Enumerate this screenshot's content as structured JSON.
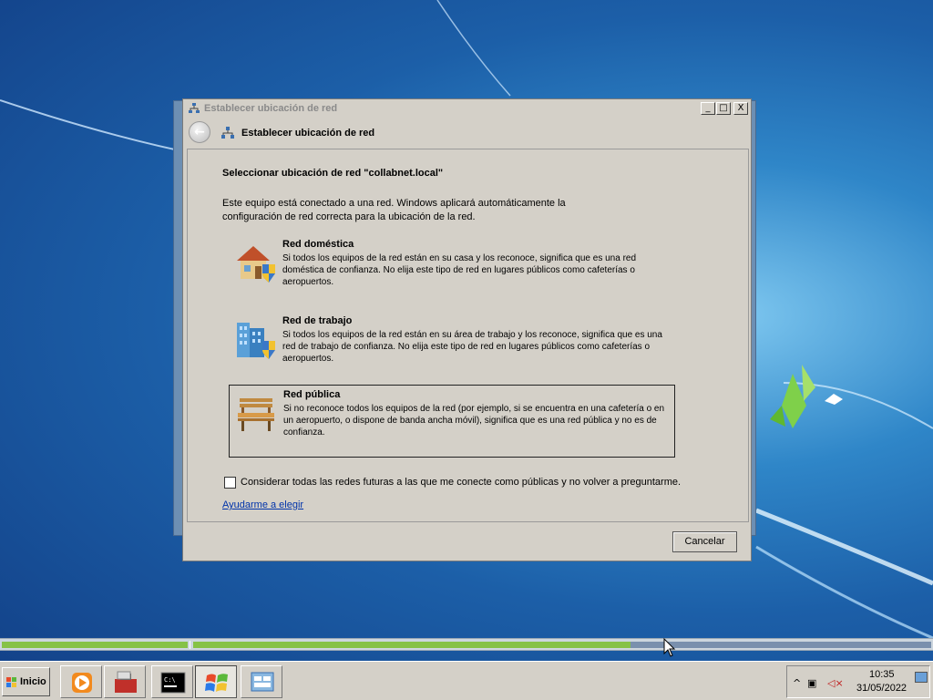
{
  "window": {
    "title": "Establecer ubicación de red",
    "minimize": "_",
    "maximize": "□",
    "close": "X",
    "nav_title": "Establecer ubicación de red",
    "back_glyph": "←"
  },
  "content": {
    "heading": "Seleccionar ubicación de red \"collabnet.local\"",
    "intro": "Este equipo está conectado a una red. Windows aplicará automáticamente la configuración de red correcta para la ubicación de la red.",
    "options": [
      {
        "title": "Red doméstica",
        "description": "Si todos los equipos de la red están en su casa y los reconoce, significa que es una red doméstica de confianza. No elija este tipo de red en lugares públicos como cafeterías o aeropuertos.",
        "icon": "home-network-icon",
        "selected": false
      },
      {
        "title": "Red de trabajo",
        "description": "Si todos los equipos de la red están en su área de trabajo y los reconoce, significa que es una red de trabajo de confianza. No elija este tipo de red en lugares públicos como cafeterías o aeropuertos.",
        "icon": "work-network-icon",
        "selected": false
      },
      {
        "title": "Red pública",
        "description": "Si no reconoce todos los equipos de la red (por ejemplo, si se encuentra en una cafetería o en un aeropuerto, o dispone de banda ancha móvil), significa que es una red pública y no es de confianza.",
        "icon": "public-network-icon",
        "selected": true
      }
    ],
    "checkbox_label": "Considerar todas las redes futuras a las que me conecte como públicas y no volver a preguntarme.",
    "checkbox_checked": false,
    "help_link": "Ayudarme a elegir"
  },
  "footer": {
    "cancel_label": "Cancelar"
  },
  "progress": {
    "fraction": 0.68,
    "fill_color": "#86c246"
  },
  "taskbar": {
    "start_label": "Inicio",
    "apps": [
      "media-player-icon",
      "toolbox-icon",
      "command-prompt-icon",
      "windows-logo-icon",
      "control-panel-icon"
    ],
    "active_app": "windows-logo-icon",
    "clock_time": "10:35",
    "clock_date": "31/05/2022",
    "tray_expand": "^"
  },
  "colors": {
    "accent_link": "#0033aa",
    "window_bg": "#d4d0c8",
    "desktop": "#1c5fa8"
  }
}
